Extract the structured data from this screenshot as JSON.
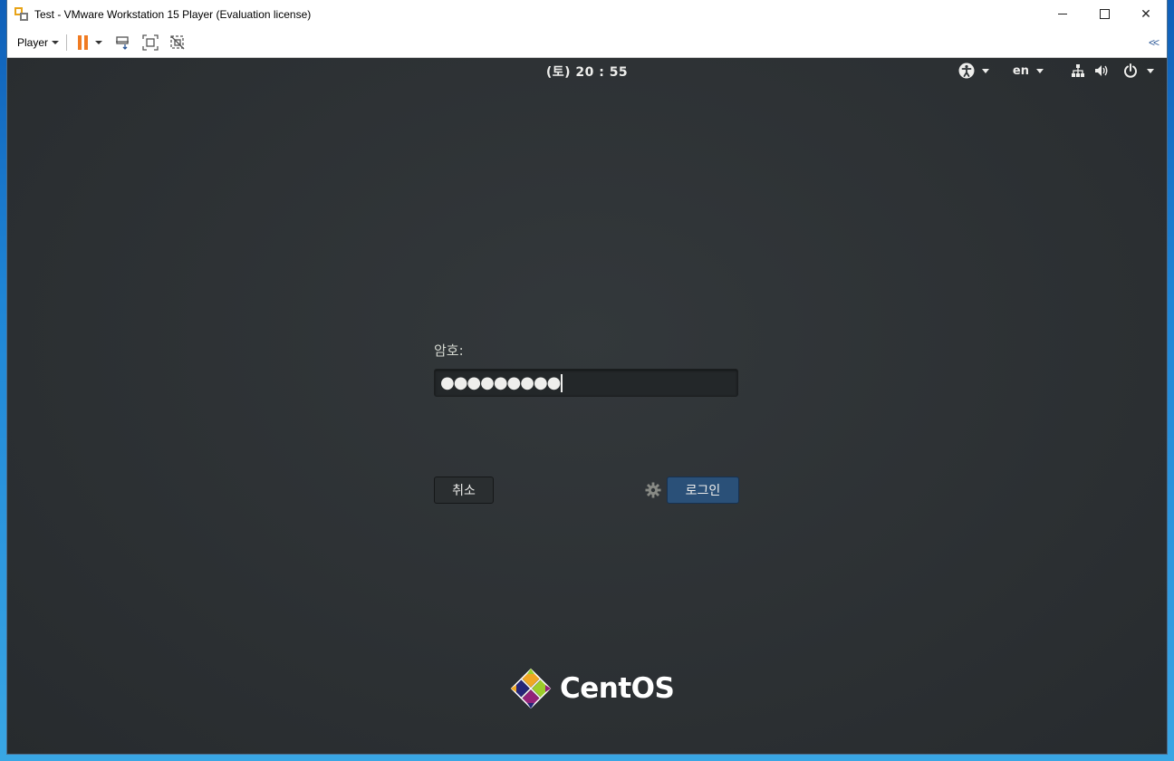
{
  "window": {
    "title": "Test - VMware Workstation 15 Player (Evaluation license)",
    "controls": {
      "minimize": "minimize",
      "maximize": "maximize",
      "close": "✕"
    }
  },
  "toolbar": {
    "player_label": "Player",
    "collapse_label": "<<",
    "icons": [
      "pause-icon",
      "send-ctrl-alt-del-icon",
      "fullscreen-icon",
      "unity-icon"
    ]
  },
  "guest": {
    "clock": "(토) 20 : 55",
    "language": "en",
    "status_icons": [
      "accessibility-icon",
      "network-icon",
      "volume-icon",
      "power-icon"
    ]
  },
  "login": {
    "password_label": "암호:",
    "password_value": "●●●●●●●●●",
    "cancel_label": "취소",
    "login_label": "로그인"
  },
  "branding": {
    "logo_text": "CentOS"
  },
  "colors": {
    "desktop_bg": "#2e3336",
    "login_button": "#2a5078",
    "pause_accent": "#f07b22",
    "titlebar": "#ffffff"
  }
}
